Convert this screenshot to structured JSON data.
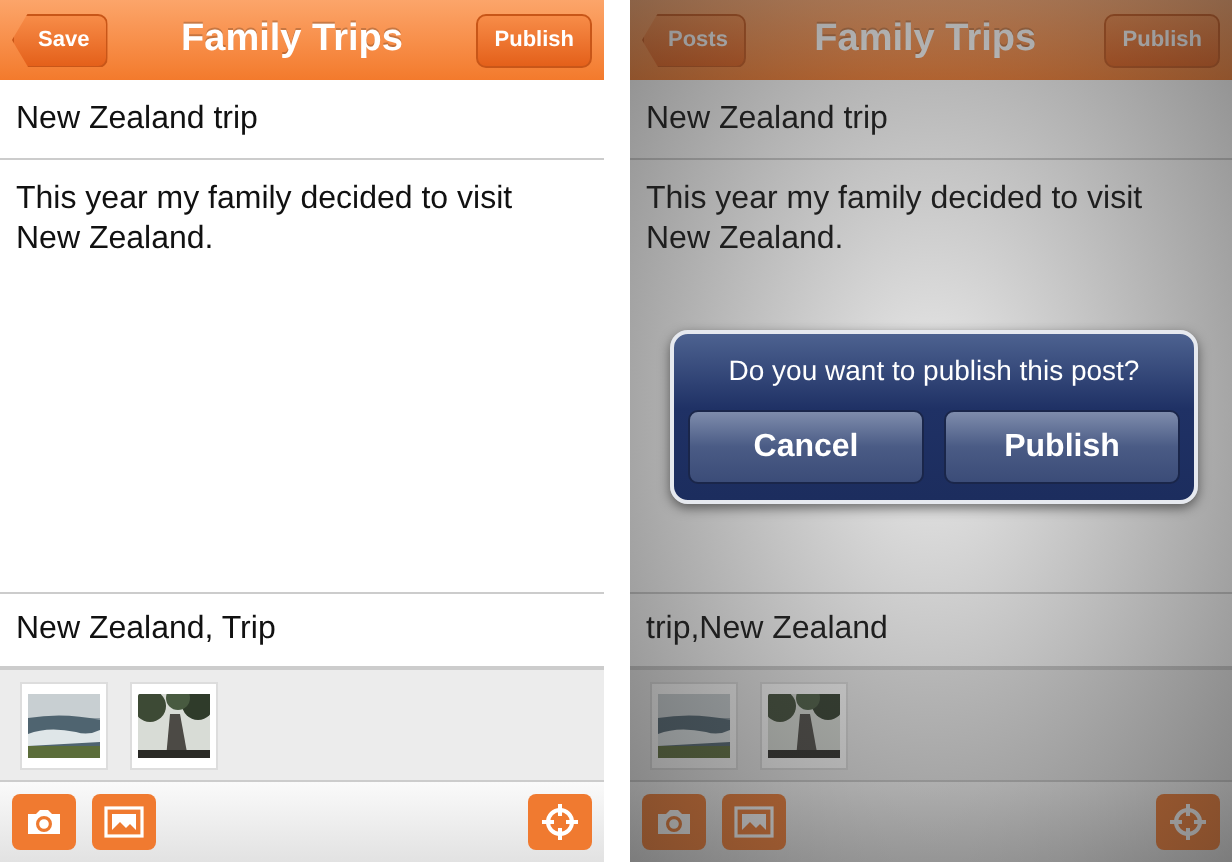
{
  "screens": [
    {
      "dimmed": false,
      "nav": {
        "back_button": "Save",
        "title": "Family Trips",
        "action_button": "Publish"
      },
      "post_title": "New Zealand trip",
      "body": "This year my family decided to visit New Zealand.",
      "tags": "New Zealand, Trip"
    },
    {
      "dimmed": true,
      "nav": {
        "back_button": "Posts",
        "title": "Family Trips",
        "action_button": "Publish"
      },
      "post_title": "New Zealand trip",
      "body": "This year my family decided to visit New Zealand.",
      "tags": "trip,New Zealand",
      "alert": {
        "message": "Do you want to publish this post?",
        "buttons": [
          "Cancel",
          "Publish"
        ]
      }
    }
  ]
}
